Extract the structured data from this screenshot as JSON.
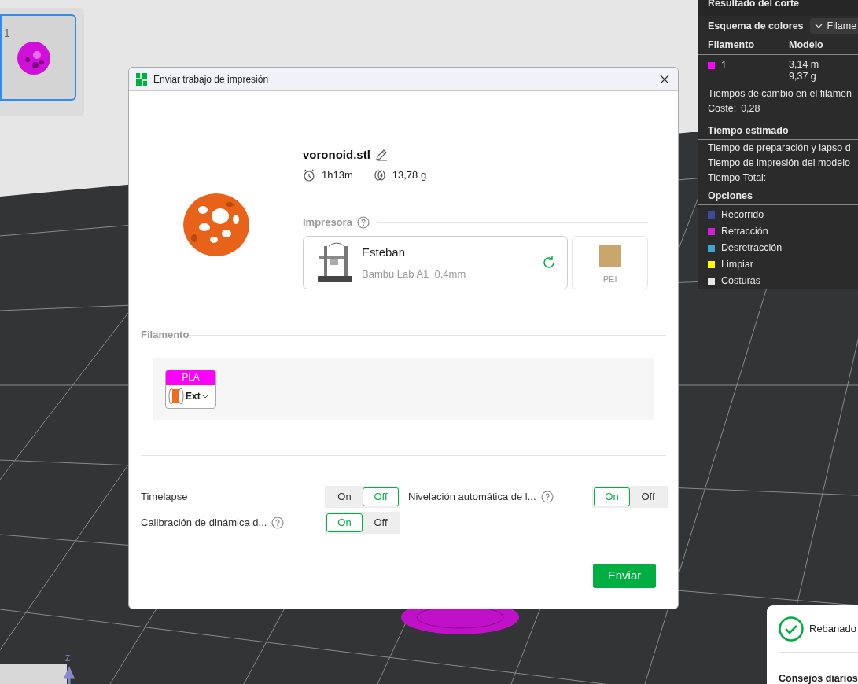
{
  "plate_list": {
    "items": [
      {
        "label": "1",
        "selected": true
      }
    ]
  },
  "slice_panel": {
    "title": "Resultado del corte",
    "color_scheme": {
      "label": "Esquema de colores",
      "value": "Filame"
    },
    "columns": [
      "Filamento",
      "Modelo"
    ],
    "filaments": [
      {
        "id": "1",
        "color": "#ff00ff",
        "length": "3,14 m",
        "weight": "9,37 g"
      }
    ],
    "change_times": "Tiempos de cambio en el filamen",
    "cost": {
      "label": "Coste:",
      "value": "0,28"
    },
    "time_title": "Tiempo estimado",
    "times": [
      "Tiempo de preparación y lapso d",
      "Tiempo de impresión del modelo",
      "Tiempo Total:"
    ],
    "options_title": "Opciones",
    "options": [
      {
        "label": "Recorrido",
        "color": "#3b4a9c"
      },
      {
        "label": "Retracción",
        "color": "#d21fd2"
      },
      {
        "label": "Desretracción",
        "color": "#3fa7cf"
      },
      {
        "label": "Limpiar",
        "color": "#ffff00"
      },
      {
        "label": "Costuras",
        "color": "#e6e6e6"
      }
    ]
  },
  "dialog": {
    "title": "Enviar trabajo de impresión",
    "file_name": "voronoid.stl",
    "time": "1h13m",
    "weight": "13,78 g",
    "printer_heading": "Impresora",
    "printer": {
      "name": "Esteban",
      "model": "Bambu Lab A1  0,4mm"
    },
    "plate": {
      "label": "PEI"
    },
    "filament_heading": "Filamento",
    "filaments": [
      {
        "type": "PLA",
        "color": "#ff00ff",
        "slot": "Ext"
      }
    ],
    "options": [
      {
        "label": "Timelapse",
        "help": false,
        "on": false,
        "on_text": "On",
        "off_text": "Off"
      },
      {
        "label": "Nivelación automática de l...",
        "help": true,
        "on": true,
        "on_text": "On",
        "off_text": "Off"
      },
      {
        "label": "Calibración de dinámica d...",
        "help": true,
        "on": true,
        "on_text": "On",
        "off_text": "Off"
      }
    ],
    "send_button": "Enviar"
  },
  "axis": {
    "label": "Z"
  },
  "toast": {
    "status": "Rebanado",
    "tips_title": "Consejos diarios"
  }
}
